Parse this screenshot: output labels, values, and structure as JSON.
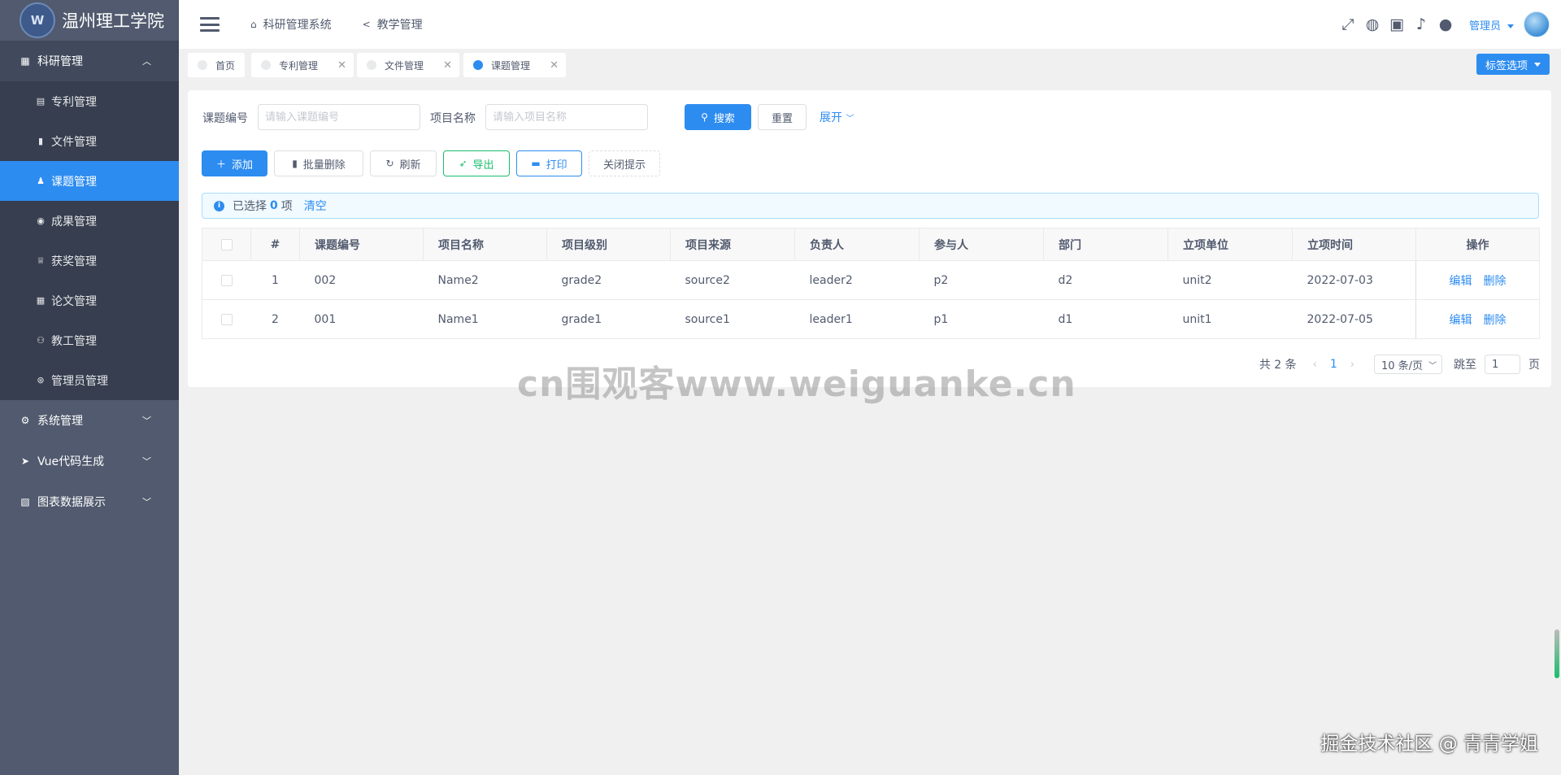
{
  "sidebar": {
    "logo_text": "温州理工学院",
    "groups": {
      "research": {
        "label": "科研管理",
        "icon": "grid-icon"
      },
      "system": {
        "label": "系统管理",
        "icon": "gear-icon"
      },
      "vue": {
        "label": "Vue代码生成",
        "icon": "send-icon"
      },
      "charts": {
        "label": "图表数据展示",
        "icon": "chart-icon"
      }
    },
    "items": [
      {
        "label": "专利管理",
        "icon": "book-icon"
      },
      {
        "label": "文件管理",
        "icon": "file-icon"
      },
      {
        "label": "课题管理",
        "icon": "person-icon"
      },
      {
        "label": "成果管理",
        "icon": "circle-icon"
      },
      {
        "label": "获奖管理",
        "icon": "trophy-icon"
      },
      {
        "label": "论文管理",
        "icon": "paper-icon"
      },
      {
        "label": "教工管理",
        "icon": "people-icon"
      },
      {
        "label": "管理员管理",
        "icon": "admin-icon"
      }
    ]
  },
  "header": {
    "breadcrumb1": "科研管理系统",
    "breadcrumb2": "教学管理",
    "admin": "管理员"
  },
  "tabs": [
    "首页",
    "专利管理",
    "文件管理",
    "课题管理"
  ],
  "tab_options": "标签选项",
  "search": {
    "code_label": "课题编号",
    "code_placeholder": "请输入课题编号",
    "name_label": "项目名称",
    "name_placeholder": "请输入项目名称",
    "search_btn": "搜索",
    "reset_btn": "重置",
    "expand": "展开"
  },
  "toolbar": {
    "add": "添加",
    "batch_delete": "批量删除",
    "refresh": "刷新",
    "export": "导出",
    "print": "打印",
    "close_tip": "关闭提示"
  },
  "alert": {
    "prefix": "已选择",
    "count": "0",
    "suffix": "项",
    "clear": "清空"
  },
  "table": {
    "headers": [
      "#",
      "课题编号",
      "项目名称",
      "项目级别",
      "项目来源",
      "负责人",
      "参与人",
      "部门",
      "立项单位",
      "立项时间",
      "操作"
    ],
    "rows": [
      [
        "1",
        "002",
        "Name2",
        "grade2",
        "source2",
        "leader2",
        "p2",
        "d2",
        "unit2",
        "2022-07-03"
      ],
      [
        "2",
        "001",
        "Name1",
        "grade1",
        "source1",
        "leader1",
        "p1",
        "d1",
        "unit1",
        "2022-07-05"
      ]
    ],
    "edit": "编辑",
    "delete": "删除"
  },
  "pagination": {
    "total": "共 2 条",
    "page": "1",
    "size": "10 条/页",
    "jump_label": "跳至",
    "jump_value": "1",
    "page_suffix": "页"
  },
  "watermark": "cn围观客www.weiguanke.cn",
  "footer_watermark": "掘金技术社区 @ 青青学姐"
}
